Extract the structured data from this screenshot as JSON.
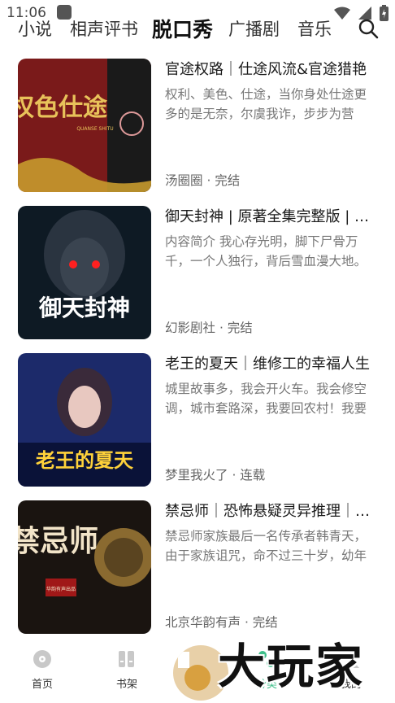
{
  "status_bar": {
    "time": "11:06"
  },
  "tabs": [
    {
      "label": "小说",
      "active": false
    },
    {
      "label": "相声评书",
      "active": false
    },
    {
      "label": "脱口秀",
      "active": true
    },
    {
      "label": "广播剧",
      "active": false
    },
    {
      "label": "音乐",
      "active": false
    }
  ],
  "books": [
    {
      "title": "官途权路｜仕途风流&官途猎艳",
      "description": "权利、美色、仕途，当你身处仕途更多的是无奈，尔虞我诈，步步为营",
      "author": "汤圈圈",
      "status": "完结",
      "cover_text": "权色仕途",
      "cover_sub": "QUANSE SHITU"
    },
    {
      "title": "御天封神 | 原著全集完整版 | 多人精品",
      "description": "内容简介 我心存光明，脚下尸骨万千，一个人独行，背后雪血漫大地。",
      "author": "幻影剧社",
      "status": "完结",
      "cover_text": "御天封神"
    },
    {
      "title": "老王的夏天｜维修工的幸福人生",
      "description": "城里故事多，我会开火车。我会修空调，城市套路深，我要回农村！我要",
      "author": "梦里我火了",
      "status": "连载",
      "cover_text": "老王的夏天"
    },
    {
      "title": "禁忌师｜恐怖悬疑灵异推理｜多人剧",
      "description": "禁忌师家族最后一名传承者韩青天，由于家族诅咒，命不过三十岁，幼年",
      "author": "北京华韵有声",
      "status": "完结",
      "cover_text": "禁忌师",
      "cover_badge": "华韵有声出品"
    }
  ],
  "bottom_nav": [
    {
      "label": "首页",
      "icon": "disc-icon",
      "active": false
    },
    {
      "label": "书架",
      "icon": "bookshelf-icon",
      "active": false
    },
    {
      "label": "分类",
      "icon": "category-icon",
      "active": true
    },
    {
      "label": "我的",
      "icon": "user-icon",
      "active": false
    }
  ],
  "watermark": {
    "text": "大玩家"
  },
  "colors": {
    "accent": "#3fbf8a",
    "meta_text": "#666666",
    "desc_text": "#777777"
  }
}
